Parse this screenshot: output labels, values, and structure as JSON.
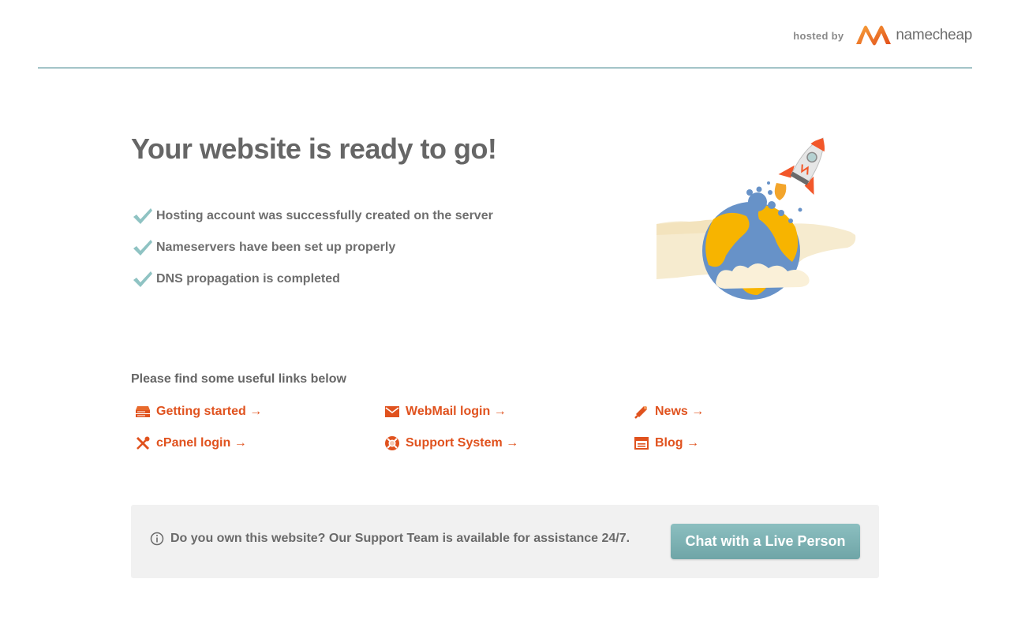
{
  "header": {
    "hosted_by": "hosted by",
    "brand": "namecheap",
    "divider_color": "#a3c4c8"
  },
  "main": {
    "headline": "Your website is ready to go!",
    "checks": [
      {
        "icon": "check-icon",
        "label": "Hosting account was successfully created on the server"
      },
      {
        "icon": "check-icon",
        "label": "Nameservers have been set up properly"
      },
      {
        "icon": "check-icon",
        "label": "DNS propagation is completed"
      }
    ]
  },
  "links": {
    "title": "Please find some useful links below",
    "items": [
      {
        "icon": "server-icon",
        "label": "Getting started →"
      },
      {
        "icon": "mail-icon",
        "label": "WebMail login →"
      },
      {
        "icon": "megaphone-icon",
        "label": "News →"
      },
      {
        "icon": "tools-icon",
        "label": "cPanel login →"
      },
      {
        "icon": "lifebuoy-icon",
        "label": "Support System →"
      },
      {
        "icon": "blog-icon",
        "label": "Blog →"
      }
    ],
    "color": "#e0521e"
  },
  "support": {
    "icon": "info-icon",
    "text": "Do you own this website? Our Support Team is available for assistance 24/7.",
    "button": "Chat with a Live Person"
  },
  "colors": {
    "accent": "#e0521e",
    "check": "#8fc3c3",
    "button": "#7fb2b4"
  }
}
